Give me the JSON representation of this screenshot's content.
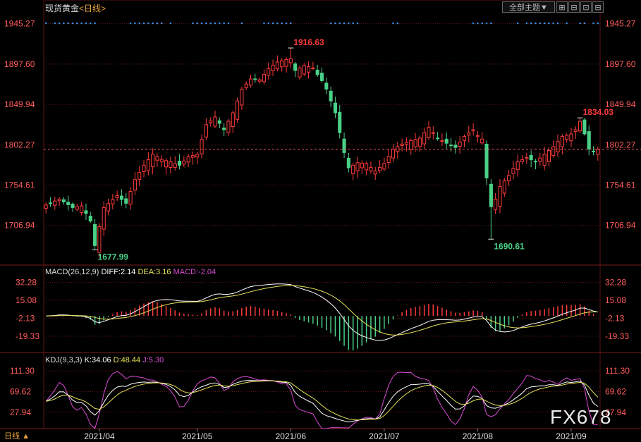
{
  "header": {
    "symbol": "现货黄金",
    "period_label": "日线",
    "open_bracket": "<",
    "close_bracket": ">",
    "theme_button": "全部主题",
    "theme_arrow": "▼",
    "btn_a": "⊞",
    "btn_b": "⊟",
    "btn_c": "⊡",
    "btn_d": "⊟"
  },
  "bottom_tab": {
    "label": "日线",
    "arrow": "▲"
  },
  "watermark": "FX678",
  "colors": {
    "up": "#ff3b3b",
    "down": "#4ad187",
    "diff": "#ffffff",
    "dea": "#e6e25a",
    "macd": "#d94cd4",
    "k_line": "#ffffff",
    "d_line": "#e6e25a",
    "j_line": "#d94cd4",
    "price_axis": "#ff5b5b",
    "grid": "#5a1414",
    "dots": "#3a8ee6",
    "dash": "#ff5b5b"
  },
  "chart_data": [
    {
      "type": "candlestick",
      "name": "现货黄金",
      "y_ticks": [
        "1945.27",
        "1897.60",
        "1849.94",
        "1802.27",
        "1754.61",
        "1706.94"
      ],
      "ylim": [
        1660,
        1955
      ],
      "x_ticks": [
        "2021/04",
        "2021/05",
        "2021/06",
        "2021/07",
        "2021/08",
        "2021/09"
      ],
      "x_tick_index": [
        12,
        34,
        55,
        76,
        97,
        118
      ],
      "current_price": 1797,
      "annotations": [
        {
          "text": "1916.63",
          "index": 55,
          "value": 1916.63,
          "color": "up"
        },
        {
          "text": "1677.99",
          "index": 11,
          "value": 1677.99,
          "color": "down"
        },
        {
          "text": "1690.61",
          "index": 100,
          "value": 1690.61,
          "color": "down"
        },
        {
          "text": "1834.03",
          "index": 120,
          "value": 1834.03,
          "color": "up"
        }
      ],
      "anchors": [
        [
          0,
          1731
        ],
        [
          3,
          1738
        ],
        [
          6,
          1728
        ],
        [
          8,
          1730
        ],
        [
          10,
          1712
        ],
        [
          11,
          1683
        ],
        [
          13,
          1728
        ],
        [
          16,
          1742
        ],
        [
          18,
          1733
        ],
        [
          20,
          1761
        ],
        [
          22,
          1778
        ],
        [
          24,
          1791
        ],
        [
          26,
          1785
        ],
        [
          28,
          1782
        ],
        [
          30,
          1778
        ],
        [
          32,
          1788
        ],
        [
          34,
          1791
        ],
        [
          36,
          1826
        ],
        [
          38,
          1835
        ],
        [
          40,
          1820
        ],
        [
          42,
          1840
        ],
        [
          44,
          1868
        ],
        [
          46,
          1880
        ],
        [
          48,
          1879
        ],
        [
          50,
          1892
        ],
        [
          52,
          1900
        ],
        [
          54,
          1903
        ],
        [
          55,
          1904
        ],
        [
          56,
          1890
        ],
        [
          58,
          1896
        ],
        [
          60,
          1893
        ],
        [
          61,
          1885
        ],
        [
          62,
          1878
        ],
        [
          63,
          1868
        ],
        [
          65,
          1840
        ],
        [
          67,
          1793
        ],
        [
          68,
          1775
        ],
        [
          70,
          1781
        ],
        [
          72,
          1780
        ],
        [
          74,
          1771
        ],
        [
          76,
          1780
        ],
        [
          78,
          1797
        ],
        [
          80,
          1803
        ],
        [
          82,
          1807
        ],
        [
          84,
          1810
        ],
        [
          86,
          1823
        ],
        [
          88,
          1810
        ],
        [
          90,
          1804
        ],
        [
          92,
          1799
        ],
        [
          94,
          1812
        ],
        [
          96,
          1820
        ],
        [
          97,
          1813
        ],
        [
          98,
          1809
        ],
        [
          99,
          1763
        ],
        [
          100,
          1729
        ],
        [
          101,
          1738
        ],
        [
          102,
          1753
        ],
        [
          104,
          1766
        ],
        [
          106,
          1782
        ],
        [
          108,
          1787
        ],
        [
          110,
          1782
        ],
        [
          112,
          1791
        ],
        [
          114,
          1800
        ],
        [
          116,
          1812
        ],
        [
          118,
          1815
        ],
        [
          119,
          1820
        ],
        [
          120,
          1830
        ],
        [
          121,
          1815
        ],
        [
          122,
          1797
        ],
        [
          123,
          1794
        ],
        [
          124,
          1797
        ]
      ]
    },
    {
      "type": "line",
      "name": "MACD",
      "params": "MACD(26,12,9)",
      "diff_label": "DIFF:2.14",
      "dea_label": "DEA:3.16",
      "macd_label": "MACD:-2.04",
      "y_ticks": [
        "32.28",
        "15.08",
        "-2.13",
        "-19.33"
      ],
      "ylim": [
        -35,
        38
      ]
    },
    {
      "type": "line",
      "name": "KDJ",
      "params": "KDJ(9,3,3)",
      "k_label": "K:34.06",
      "d_label": "D:48.44",
      "j_label": "J:5.30",
      "y_ticks": [
        "111.30",
        "69.62",
        "27.94"
      ],
      "ylim": [
        -5,
        120
      ]
    }
  ]
}
